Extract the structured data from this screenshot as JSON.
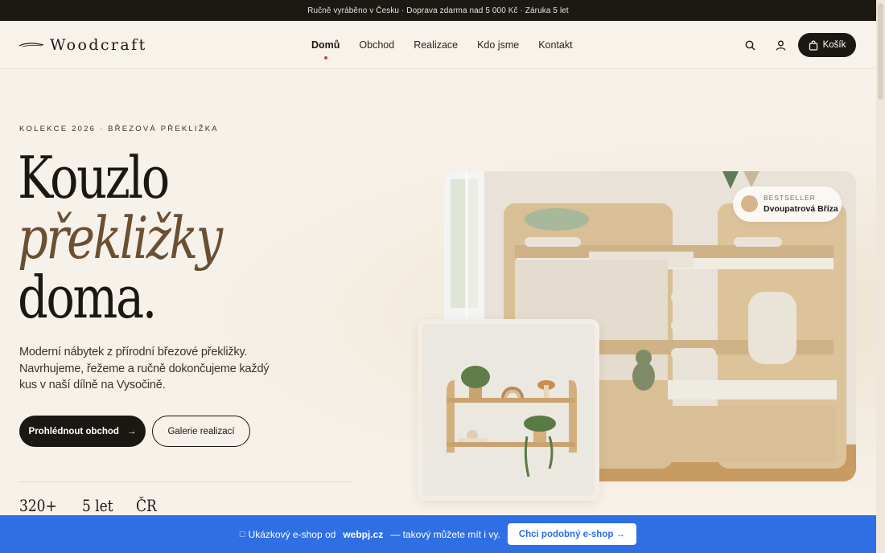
{
  "topbar": {
    "text": "Ručně vyráběno v Česku · Doprava zdarma nad 5 000 Kč · Záruka 5 let"
  },
  "header": {
    "logo_text": "Woodcraft",
    "nav": [
      {
        "label": "Domů",
        "active": true
      },
      {
        "label": "Obchod",
        "active": false
      },
      {
        "label": "Realizace",
        "active": false
      },
      {
        "label": "Kdo jsme",
        "active": false
      },
      {
        "label": "Kontakt",
        "active": false
      }
    ],
    "search_icon": "search-icon",
    "account_icon": "user-icon",
    "cart_label": "Košík",
    "cart_icon": "shopping-bag-icon"
  },
  "hero": {
    "eyebrow": "KOLEKCE 2026 · BŘEZOVÁ PŘEKLIŽKA",
    "headline_line1": "Kouzlo",
    "headline_line2": "překližky",
    "headline_line3": "doma.",
    "lead": "Moderní nábytek z přírodní březové překližky. Navrhujeme, řežeme a ručně dokončujeme každý kus v naší dílně na Vysočině.",
    "primary_button": "Prohlédnout obchod",
    "primary_button_arrow": "→",
    "secondary_button": "Galerie realizací",
    "stats": [
      "320+",
      "5 let",
      "ČR"
    ]
  },
  "badge": {
    "label": "BESTSELLER",
    "name": "Dvoupatrová Bříza"
  },
  "promo": {
    "icon": "□",
    "text_before": "Ukázkový e-shop od",
    "brand": "webpj.cz",
    "text_after": "— takový můžete mít i vy.",
    "button": "Chci podobný e-shop →"
  },
  "colors": {
    "background": "#f6f1e9",
    "dark": "#1b1712",
    "accent_brown": "#6a4f33",
    "promo_blue": "#2f6fe4",
    "active_dot": "#c84a3d"
  }
}
